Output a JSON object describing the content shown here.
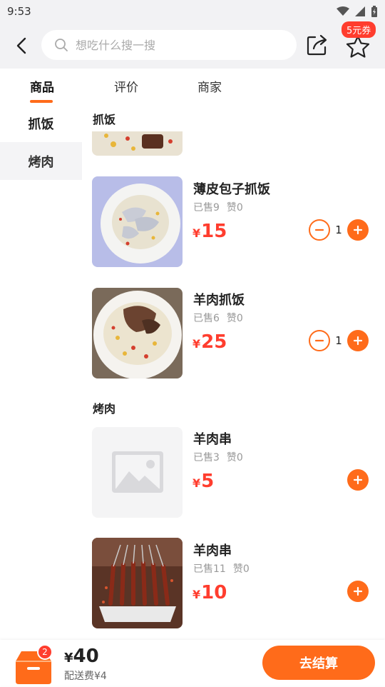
{
  "status": {
    "time": "9:53"
  },
  "header": {
    "search_placeholder": "想吃什么搜一搜",
    "coupon_label": "5元券"
  },
  "tabs": [
    {
      "label": "商品",
      "active": true
    },
    {
      "label": "评价",
      "active": false
    },
    {
      "label": "商家",
      "active": false
    }
  ],
  "sidebar": {
    "items": [
      {
        "label": "抓饭",
        "selected": true
      },
      {
        "label": "烤肉",
        "selected": false
      }
    ]
  },
  "sections": [
    {
      "title": "抓饭",
      "items": [
        {
          "name": "薄皮包子抓饭",
          "sold": "已售9",
          "likes": "赞0",
          "currency": "¥",
          "price": "15",
          "quantity": "1"
        },
        {
          "name": "羊肉抓饭",
          "sold": "已售6",
          "likes": "赞0",
          "currency": "¥",
          "price": "25",
          "quantity": "1"
        }
      ]
    },
    {
      "title": "烤肉",
      "items": [
        {
          "name": "羊肉串",
          "sold": "已售3",
          "likes": "赞0",
          "currency": "¥",
          "price": "5"
        },
        {
          "name": "羊肉串",
          "sold": "已售11",
          "likes": "赞0",
          "currency": "¥",
          "price": "10"
        }
      ]
    }
  ],
  "cart": {
    "badge_count": "2",
    "currency": "¥",
    "total": "40",
    "delivery_fee": "配送费¥4",
    "checkout_label": "去结算"
  },
  "colors": {
    "accent": "#ff6b1a",
    "price": "#ff3d2e",
    "badge": "#ff3d2e"
  }
}
